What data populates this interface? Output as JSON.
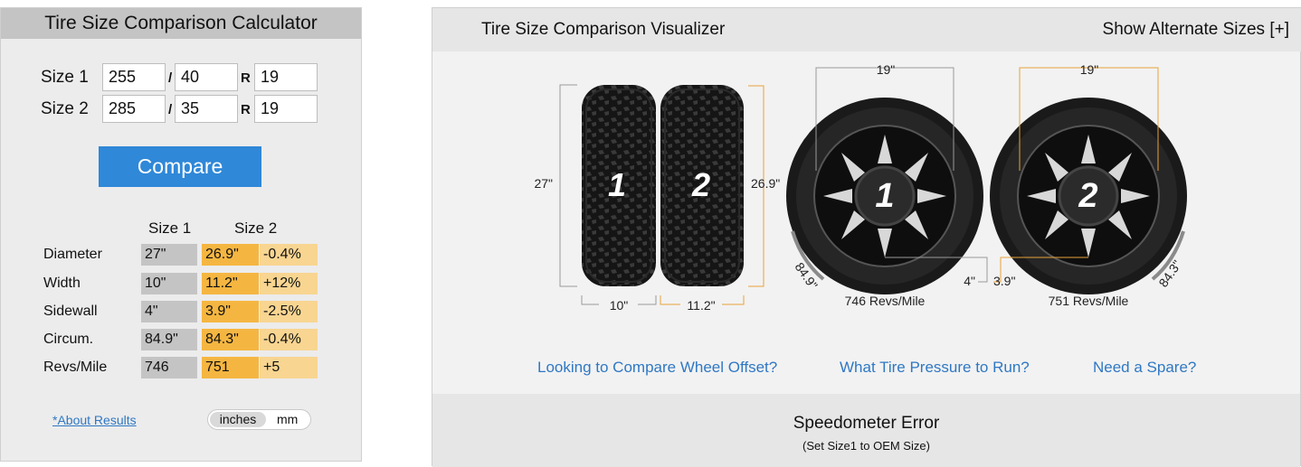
{
  "calculator": {
    "title": "Tire Size Comparison Calculator",
    "size1": {
      "label": "Size 1",
      "width": "255",
      "aspect": "40",
      "rim": "19"
    },
    "size2": {
      "label": "Size 2",
      "width": "285",
      "aspect": "35",
      "rim": "19"
    },
    "slash": "/",
    "r": "R",
    "compare_label": "Compare",
    "col_size1": "Size 1",
    "col_size2": "Size 2",
    "rows": [
      {
        "label": "Diameter",
        "s1": "27\"",
        "s2": "26.9\"",
        "diff": "-0.4%"
      },
      {
        "label": "Width",
        "s1": "10\"",
        "s2": "11.2\"",
        "diff": "+12%"
      },
      {
        "label": "Sidewall",
        "s1": "4\"",
        "s2": "3.9\"",
        "diff": "-2.5%"
      },
      {
        "label": "Circum.",
        "s1": "84.9\"",
        "s2": "84.3\"",
        "diff": "-0.4%"
      },
      {
        "label": "Revs/Mile",
        "s1": "746",
        "s2": "751",
        "diff": "+5"
      }
    ],
    "about_link": "*About Results",
    "unit_inches": "inches",
    "unit_mm": "mm"
  },
  "visualizer": {
    "title": "Tire Size Comparison Visualizer",
    "alt_sizes": "Show Alternate Sizes [+]",
    "tire1_num": "1",
    "tire2_num": "2",
    "dia1": "27\"",
    "dia2": "26.9\"",
    "width1": "10\"",
    "width2": "11.2\"",
    "rim1": "19\"",
    "rim2": "19\"",
    "side1": "4\"",
    "side2": "3.9\"",
    "circ1": "84.9\"",
    "circ2": "84.3\"",
    "revs1": "746 Revs/Mile",
    "revs2": "751 Revs/Mile",
    "link_offset": "Looking to Compare Wheel Offset?",
    "link_pressure": "What Tire Pressure to Run?",
    "link_spare": "Need a Spare?",
    "speedo_title": "Speedometer Error",
    "speedo_sub": "(Set Size1 to OEM Size)"
  },
  "colors": {
    "accent": "#2f88d8",
    "size1": "#c4c4c4",
    "size2": "#f5b641",
    "diff": "#f8d591",
    "link": "#2f78c4"
  }
}
